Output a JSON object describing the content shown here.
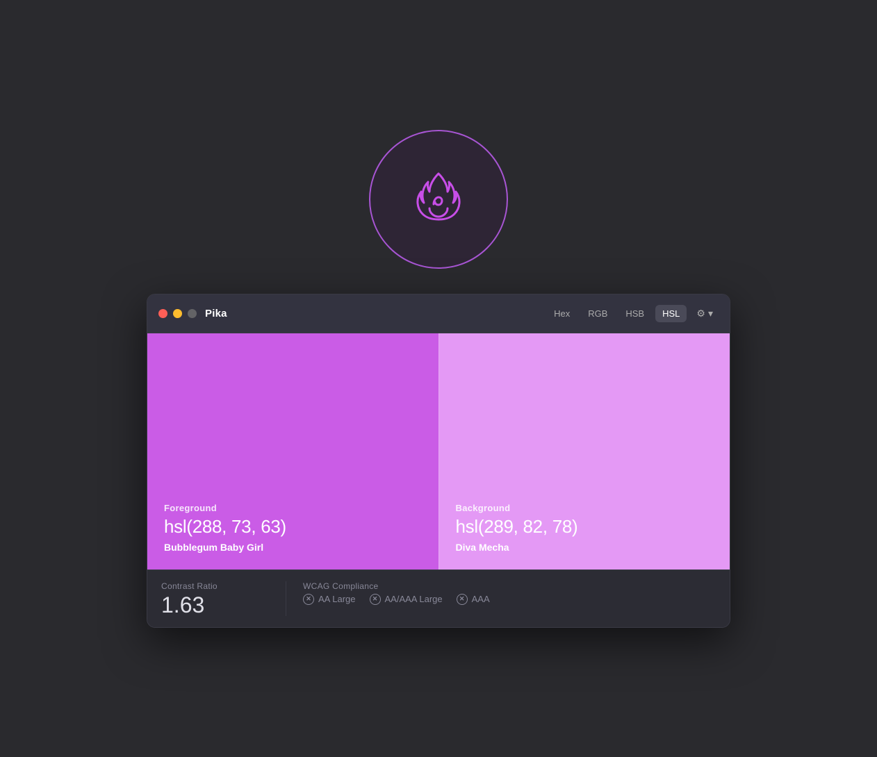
{
  "app": {
    "title": "Pika",
    "icon_label": "Pika flame icon"
  },
  "titlebar": {
    "traffic_lights": {
      "close": "close",
      "minimize": "minimize",
      "fullscreen": "fullscreen"
    },
    "format_buttons": [
      "Hex",
      "RGB",
      "HSB",
      "HSL"
    ],
    "active_format": "HSL",
    "settings_label": "⚙",
    "chevron_label": "▾"
  },
  "foreground": {
    "label": "Foreground",
    "value": "hsl(288, 73, 63)",
    "name": "Bubblegum Baby Girl",
    "bg_color": "hsl(288, 73%, 63%)"
  },
  "background": {
    "label": "Background",
    "value": "hsl(289, 82, 78)",
    "name": "Diva Mecha",
    "bg_color": "hsl(289, 82%, 78%)"
  },
  "contrast": {
    "section_label": "Contrast Ratio",
    "value": "1.63"
  },
  "wcag": {
    "section_label": "WCAG Compliance",
    "items": [
      {
        "label": "AA Large"
      },
      {
        "label": "AA/AAA Large"
      },
      {
        "label": "AAA"
      }
    ]
  }
}
